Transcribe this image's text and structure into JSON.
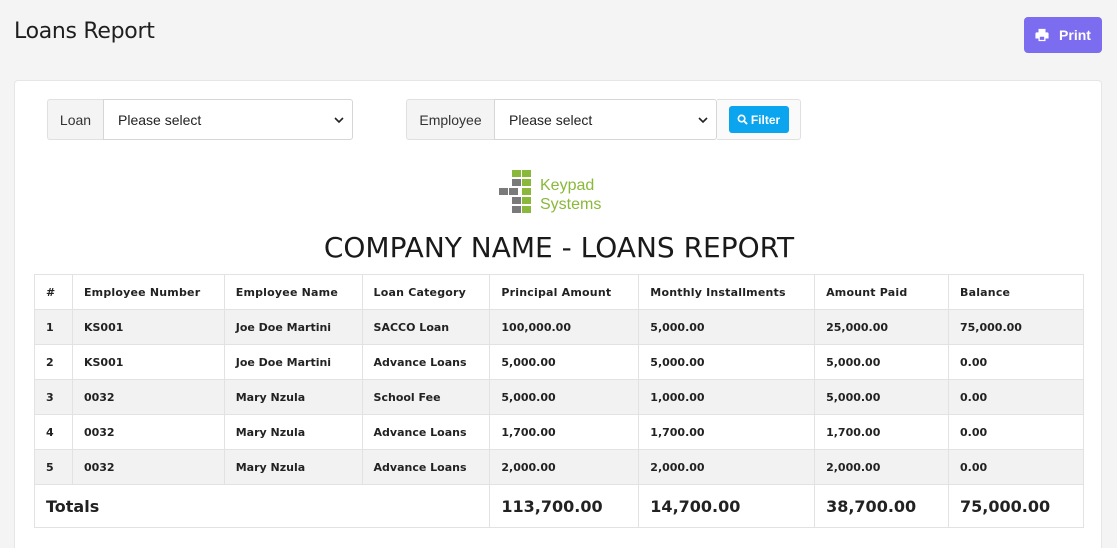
{
  "header": {
    "title": "Loans Report",
    "print_label": "Print"
  },
  "filters": {
    "loan_label": "Loan",
    "loan_value": "Please select",
    "employee_label": "Employee",
    "employee_value": "Please select",
    "filter_label": "Filter"
  },
  "logo": {
    "line1": "Keypad",
    "line2": "Systems"
  },
  "report": {
    "title": "COMPANY NAME - LOANS REPORT",
    "columns": [
      "#",
      "Employee Number",
      "Employee Name",
      "Loan Category",
      "Principal Amount",
      "Monthly Installments",
      "Amount Paid",
      "Balance"
    ],
    "rows": [
      [
        "1",
        "KS001",
        "Joe Doe Martini",
        "SACCO Loan",
        "100,000.00",
        "5,000.00",
        "25,000.00",
        "75,000.00"
      ],
      [
        "2",
        "KS001",
        "Joe Doe Martini",
        "Advance Loans",
        "5,000.00",
        "5,000.00",
        "5,000.00",
        "0.00"
      ],
      [
        "3",
        "0032",
        "Mary Nzula",
        "School Fee",
        "5,000.00",
        "1,000.00",
        "5,000.00",
        "0.00"
      ],
      [
        "4",
        "0032",
        "Mary Nzula",
        "Advance Loans",
        "1,700.00",
        "1,700.00",
        "1,700.00",
        "0.00"
      ],
      [
        "5",
        "0032",
        "Mary Nzula",
        "Advance Loans",
        "2,000.00",
        "2,000.00",
        "2,000.00",
        "0.00"
      ]
    ],
    "totals": {
      "label": "Totals",
      "principal": "113,700.00",
      "monthly": "14,700.00",
      "paid": "38,700.00",
      "balance": "75,000.00"
    }
  },
  "colors": {
    "print_button": "#7c6cf0",
    "filter_button": "#0aa5ee",
    "logo_green": "#8ab83a"
  }
}
